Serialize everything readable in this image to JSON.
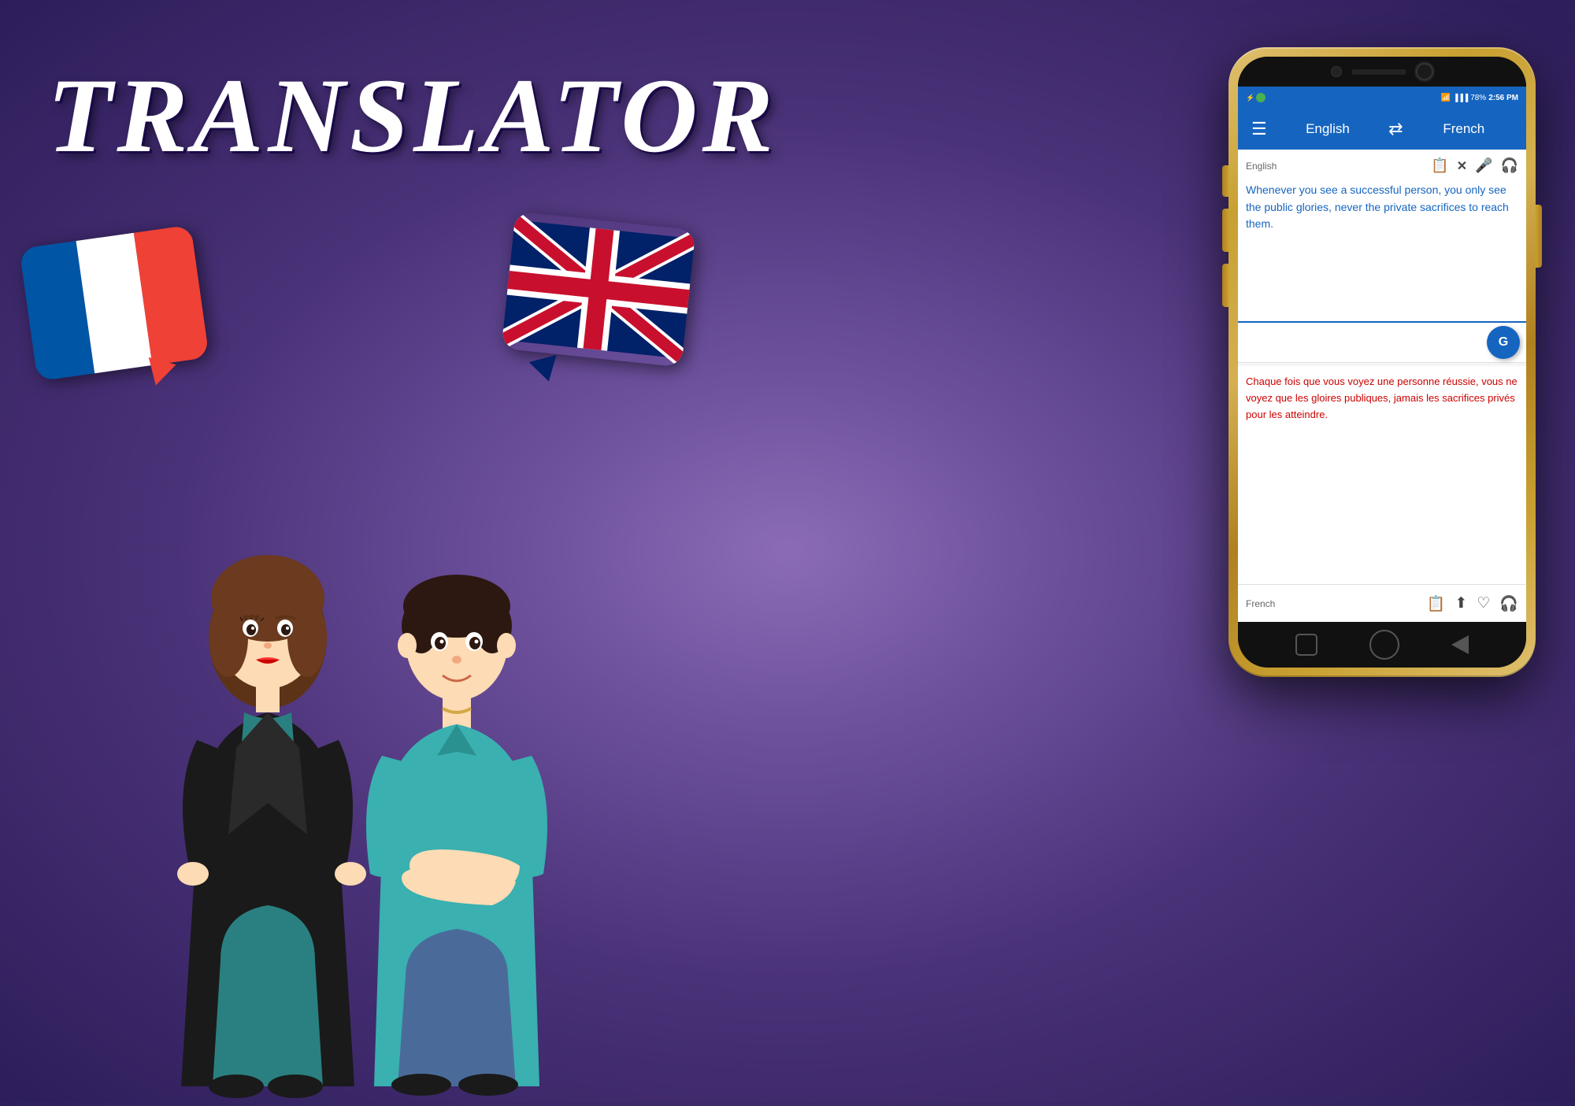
{
  "title": "TRANSLATOR",
  "background": {
    "gradient_start": "#7b5ea7",
    "gradient_end": "#2e1f5e"
  },
  "phone": {
    "status_bar": {
      "usb_icon": "⚡",
      "wifi": "WiFi",
      "signal": "▐▐▐",
      "battery": "78%",
      "time": "2:56 PM"
    },
    "header": {
      "menu_icon": "☰",
      "lang_from": "English",
      "swap_icon": "⇄",
      "lang_to": "French"
    },
    "source": {
      "label": "English",
      "text": "Whenever you see a successful person, you only see the public glories, never the private sacrifices to reach them.",
      "icons": {
        "clipboard": "📋",
        "close": "✕",
        "mic": "🎤",
        "listen": "🎧"
      }
    },
    "translate_button": "G",
    "result": {
      "text": "Chaque fois que vous voyez une personne réussie, vous ne voyez que les gloires publiques, jamais les sacrifices privés pour les atteindre."
    },
    "bottom": {
      "label": "French",
      "icons": {
        "copy": "📋",
        "share": "⬆",
        "heart": "♡",
        "listen": "🎧"
      }
    }
  },
  "flags": {
    "french": {
      "colors": [
        "#0055A4",
        "#FFFFFF",
        "#EF4135"
      ],
      "label": "French flag"
    },
    "uk": {
      "label": "UK flag"
    }
  },
  "characters": {
    "girl": "cartoon girl with brown hair and black jacket",
    "boy": "cartoon boy with dark hair and teal shirt"
  }
}
